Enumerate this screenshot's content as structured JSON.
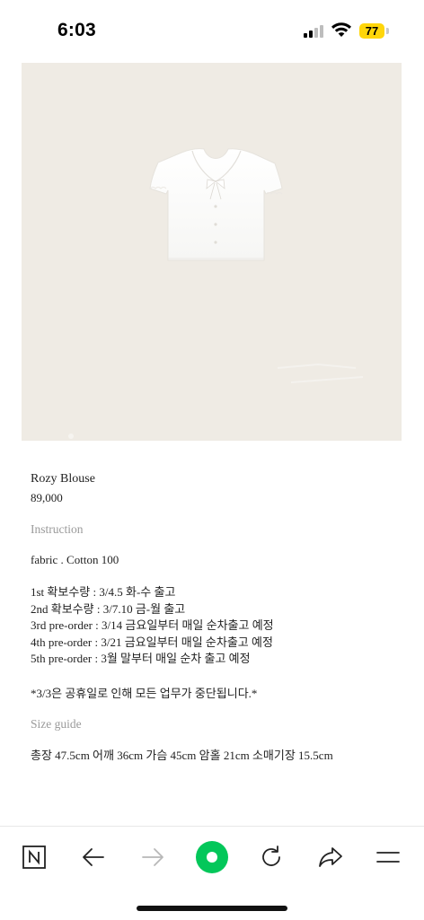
{
  "status_bar": {
    "time": "6:03",
    "battery_level": "77",
    "battery_color": "#ffd60a"
  },
  "product": {
    "image_description_icon": "blouse-photo",
    "image_background": "#efebe4",
    "name": "Rozy Blouse",
    "price": "89,000"
  },
  "instruction": {
    "label": "Instruction",
    "fabric": "fabric . Cotton 100",
    "orders": [
      "1st 확보수량 : 3/4.5 화-수 출고",
      "2nd 확보수량 : 3/7.10 금-월 출고",
      "3rd pre-order : 3/14 금요일부터 매일 순차출고 예정",
      "4th pre-order : 3/21 금요일부터 매일 순차출고 예정",
      "5th pre-order : 3월 말부터 매일 순차 출고 예정"
    ],
    "notice": "*3/3은 공휴일로 인해 모든 업무가 중단됩니다.*"
  },
  "size_guide": {
    "label": "Size guide",
    "text": "총장 47.5cm 어깨 36cm 가슴 45cm 암홀 21cm 소매기장 15.5cm"
  },
  "toolbar": {
    "buttons": [
      "naver-home-icon",
      "back-arrow-icon",
      "forward-arrow-icon",
      "green-dot-icon",
      "reload-icon",
      "share-icon",
      "menu-icon"
    ],
    "accent_color": "#03c75a"
  }
}
